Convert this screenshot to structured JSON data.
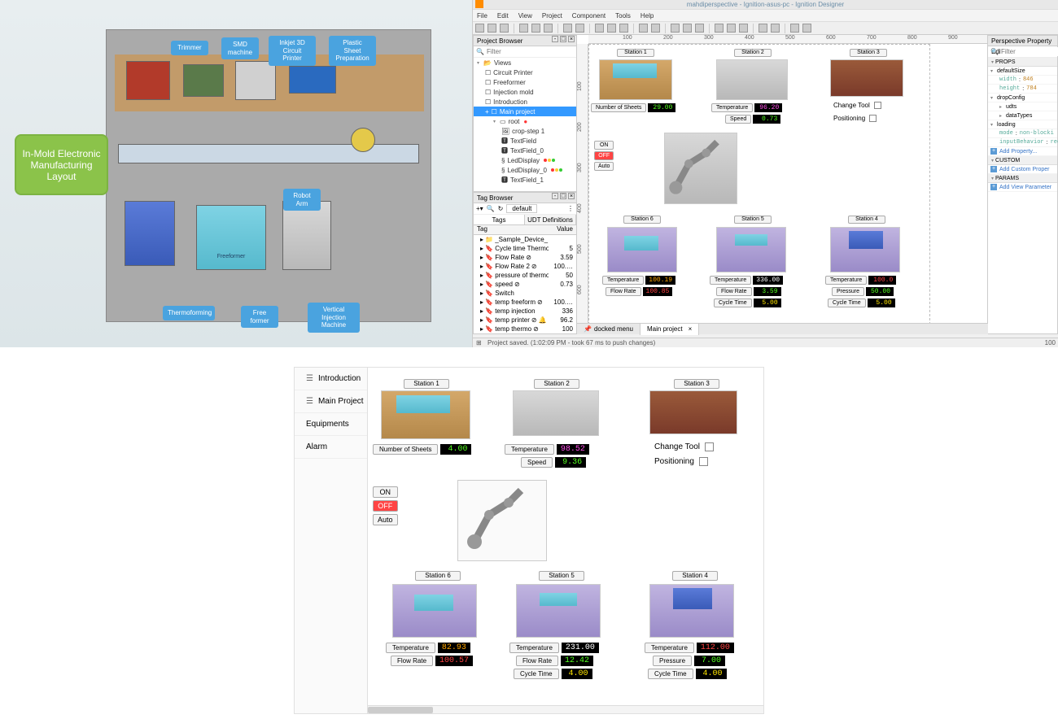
{
  "layout": {
    "title": "In-Mold Electronic Manufacturing Layout",
    "labels": {
      "trimmer": "Trimmer",
      "smd": "SMD machine",
      "inkjet": "Inkjet 3D Circuit Printer",
      "plastic": "Plastic Sheet Preparation",
      "robot": "Robot Arm",
      "thermo": "Thermoforming",
      "freeformer": "Free former",
      "vertical": "Vertical Injection Machine"
    },
    "freeformer_text": "Freeformer"
  },
  "designer": {
    "title": "mahdiperspective - Ignition-asus-pc - Ignition Designer",
    "menu": [
      "File",
      "Edit",
      "View",
      "Project",
      "Component",
      "Tools",
      "Help"
    ],
    "project_browser": {
      "title": "Project Browser",
      "filter_placeholder": "Filter",
      "views": "Views",
      "items": [
        "Circuit Printer",
        "Freeformer",
        "Injection mold",
        "Introduction"
      ],
      "main_project": "Main project",
      "root": "root",
      "sub_items": [
        "crop-step 1",
        "TextField",
        "TextField_0",
        "LedDisplay",
        "LedDisplay_0",
        "TextField_1"
      ]
    },
    "tag_browser": {
      "title": "Tag Browser",
      "default": "default",
      "tabs": [
        "Tags",
        "UDT Definitions"
      ],
      "cols": [
        "Tag",
        "Value"
      ],
      "rows": [
        {
          "name": "_Sample_Device_",
          "val": ""
        },
        {
          "name": "Cycle time Thermo",
          "val": "5"
        },
        {
          "name": "Flow Rate",
          "val": "3.59"
        },
        {
          "name": "Flow Rate 2",
          "val": "100.…"
        },
        {
          "name": "pressure of thermo",
          "val": "50"
        },
        {
          "name": "speed",
          "val": "0.73"
        },
        {
          "name": "Switch",
          "val": ""
        },
        {
          "name": "temp freeform",
          "val": "100.…"
        },
        {
          "name": "temp injection",
          "val": "336"
        },
        {
          "name": "temp printer",
          "val": "96.2"
        },
        {
          "name": "temp thermo",
          "val": "100"
        }
      ]
    },
    "ruler_marks": [
      "100",
      "200",
      "300",
      "400",
      "500",
      "600",
      "700",
      "800",
      "900"
    ],
    "stations": {
      "s1": {
        "label": "Station 1",
        "r1_label": "Number of Sheets",
        "r1_val": "29.00"
      },
      "s2": {
        "label": "Station 2",
        "r1_label": "Temperature",
        "r1_val": "96.20",
        "r2_label": "Speed",
        "r2_val": "0.73"
      },
      "s3": {
        "label": "Station 3",
        "change_tool": "Change Tool",
        "positioning": "Positioning"
      },
      "s4": {
        "label": "Station 4",
        "r1_label": "Temperature",
        "r1_val": "100.0",
        "r2_label": "Pressure",
        "r2_val": "50.00",
        "r3_label": "Cycle Time",
        "r3_val": "5.00"
      },
      "s5": {
        "label": "Station 5",
        "r1_label": "Temperature",
        "r1_val": "336.00",
        "r2_label": "Flow Rate",
        "r2_val": "3.59",
        "r3_label": "Cycle Time",
        "r3_val": "5.00"
      },
      "s6": {
        "label": "Station 6",
        "r1_label": "Temperature",
        "r1_val": "100.19",
        "r2_label": "Flow Rate",
        "r2_val": "100.85"
      },
      "robot": {
        "on": "ON",
        "off": "OFF",
        "auto": "Auto"
      }
    },
    "property_editor": {
      "title": "Perspective Property Editor",
      "filter_placeholder": "Filter",
      "sections": {
        "props": "PROPS",
        "custom": "CUSTOM",
        "params": "PARAMS"
      },
      "defaultSize": "defaultSize",
      "width_key": "width",
      "width_val": "846",
      "height_key": "height",
      "height_val": "784",
      "dropConfig": "dropConfig",
      "udts": "udts",
      "dataTypes": "dataTypes",
      "loading": "loading",
      "mode_key": "mode",
      "mode_val": "non-blocki",
      "inputBehavior_key": "inputBehavior",
      "inputBehavior_val": "req",
      "add_property": "Add Property...",
      "add_custom": "Add Custom Proper",
      "add_view_params": "Add View Parameter"
    },
    "view_tabs": {
      "t1": "docked menu",
      "t2": "Main project"
    },
    "status": "Project saved. (1:02:09 PM - took 67 ms to push changes)",
    "status_right": "100"
  },
  "runtime": {
    "nav": [
      "Introduction",
      "Main Project",
      "Equipments",
      "Alarm"
    ],
    "stations": {
      "s1": {
        "label": "Station 1",
        "r1_label": "Number of Sheets",
        "r1_val": "4.00"
      },
      "s2": {
        "label": "Station 2",
        "r1_label": "Temperature",
        "r1_val": "98.52",
        "r2_label": "Speed",
        "r2_val": "9.36"
      },
      "s3": {
        "label": "Station 3",
        "change_tool": "Change Tool",
        "positioning": "Positioning"
      },
      "s4": {
        "label": "Station 4",
        "r1_label": "Temperature",
        "r1_val": "112.00",
        "r2_label": "Pressure",
        "r2_val": "7.00",
        "r3_label": "Cycle Time",
        "r3_val": "4.00"
      },
      "s5": {
        "label": "Station 5",
        "r1_label": "Temperature",
        "r1_val": "231.00",
        "r2_label": "Flow Rate",
        "r2_val": "12.42",
        "r3_label": "Cycle Time",
        "r3_val": "4.00"
      },
      "s6": {
        "label": "Station 6",
        "r1_label": "Temperature",
        "r1_val": "82.93",
        "r2_label": "Flow Rate",
        "r2_val": "100.57"
      },
      "robot": {
        "on": "ON",
        "off": "OFF",
        "auto": "Auto"
      }
    }
  }
}
